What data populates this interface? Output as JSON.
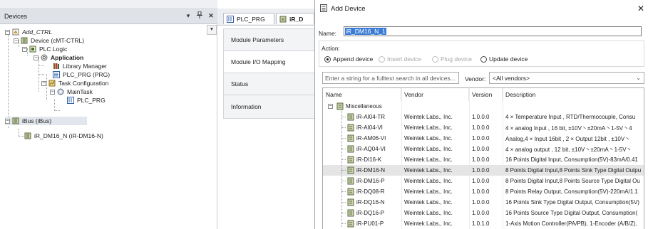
{
  "devices_panel": {
    "title": "Devices",
    "pin_glyph": "▾",
    "dock_glyph": "ᵻ",
    "close_glyph": "✕",
    "scroll_glyph": "▼",
    "tree": [
      {
        "label": "Add_CTRL",
        "italic": true,
        "toggle": "−",
        "icon": "project-icon"
      },
      {
        "label": "Device (cMT-CTRL)",
        "toggle": "−",
        "icon": "device-icon"
      },
      {
        "label": "PLC Logic",
        "toggle": "−",
        "icon": "plc-logic-icon"
      },
      {
        "label": "Application",
        "bold": true,
        "toggle": "−",
        "icon": "application-gear-icon"
      },
      {
        "label": "Library Manager",
        "icon": "library-manager-icon"
      },
      {
        "label": "PLC_PRG (PRG)",
        "icon": "program-icon"
      },
      {
        "label": "Task Configuration",
        "toggle": "−",
        "icon": "task-configuration-icon"
      },
      {
        "label": "MainTask",
        "toggle": "−",
        "icon": "maintask-gear-icon"
      },
      {
        "label": "PLC_PRG",
        "icon": "program-call-icon"
      },
      {
        "label": "iBus (iBus)",
        "toggle": "−",
        "icon": "ibus-icon",
        "selected": true
      },
      {
        "label": "iR_DM16_N (iR-DM16-N)",
        "icon": "module-icon"
      }
    ]
  },
  "editor": {
    "tabs": [
      {
        "label": "PLC_PRG",
        "icon": "program-tab-icon"
      },
      {
        "label": "iR_D",
        "icon": "module-tab-icon"
      }
    ],
    "side_items": [
      {
        "label": "Module Parameters"
      },
      {
        "label": "Module I/O Mapping",
        "active": true
      },
      {
        "label": "Status"
      },
      {
        "label": "Information"
      }
    ]
  },
  "dialog": {
    "title": "Add Device",
    "close_glyph": "✕",
    "name_label": "Name:",
    "name_value": "iR_DM16_N_1",
    "action_label": "Action:",
    "actions": [
      {
        "label": "Append device",
        "selected": true,
        "enabled": true
      },
      {
        "label": "Insert device",
        "selected": false,
        "enabled": false
      },
      {
        "label": "Plug device",
        "selected": false,
        "enabled": false
      },
      {
        "label": "Update device",
        "selected": false,
        "enabled": true
      }
    ],
    "search_placeholder": "Enter a string for a fulltext search in all devices...",
    "vendor_label": "Vendor:",
    "vendor_value": "<All vendors>",
    "vendor_chevron": "⌄",
    "columns": [
      "Name",
      "Vendor",
      "Version",
      "Description"
    ],
    "category": {
      "label": "Miscellaneous",
      "toggle": "−"
    },
    "devices": [
      {
        "name": "iR-AI04-TR",
        "vendor": "Weintek Labs., Inc.",
        "version": "1.0.0.0",
        "description": "4 × Temperature Input , RTD/Thermocouple, Consu"
      },
      {
        "name": "iR-AI04-VI",
        "vendor": "Weintek Labs., Inc.",
        "version": "1.0.0.0",
        "description": "4 × analog Input , 16 bit, ±10V丶±20mA丶1-5V丶4"
      },
      {
        "name": "iR-AM06-VI",
        "vendor": "Weintek Labs., Inc.",
        "version": "1.0.0.0",
        "description": "Analog,4 × Input 16bit , 2 × Output 12bit , ±10V丶"
      },
      {
        "name": "iR-AQ04-VI",
        "vendor": "Weintek Labs., Inc.",
        "version": "1.0.0.0",
        "description": "4 × analog output , 12 bit, ±10V丶±20mA丶1-5V丶"
      },
      {
        "name": "iR-DI16-K",
        "vendor": "Weintek Labs., Inc.",
        "version": "1.0.0.0",
        "description": "16 Points Digital Input, Consumption(5V)-83mA/0.41"
      },
      {
        "name": "iR-DM16-N",
        "vendor": "Weintek Labs., Inc.",
        "version": "1.0.0.0",
        "description": "8 Points Digital Input,8 Points Sink Type Digital Outpu",
        "hover": true
      },
      {
        "name": "iR-DM16-P",
        "vendor": "Weintek Labs., Inc.",
        "version": "1.0.0.0",
        "description": "8 Points Digital Input,8 Points Source Type Digital Ou"
      },
      {
        "name": "iR-DQ08-R",
        "vendor": "Weintek Labs., Inc.",
        "version": "1.0.0.0",
        "description": "8 Points Relay Output, Consumption(5V)-220mA/1.1"
      },
      {
        "name": "iR-DQ16-N",
        "vendor": "Weintek Labs., Inc.",
        "version": "1.0.0.0",
        "description": "16 Points Sink Type Digital Output, Consumption(5V)"
      },
      {
        "name": "iR-DQ16-P",
        "vendor": "Weintek Labs., Inc.",
        "version": "1.0.0.0",
        "description": "16 Points Source Type Digital Output, Consumption("
      },
      {
        "name": "iR-PU01-P",
        "vendor": "Weintek Labs., Inc.",
        "version": "1.0.1.0",
        "description": "1-Axis Motion Controller(PA/PB), 1-Encoder (A/B/Z),"
      }
    ]
  },
  "colors": {
    "selection": "#3a7bd5",
    "hover_row": "#e5e5e5",
    "panel_header": "#dfe3e8",
    "tree_selected": "#e2e7ee"
  }
}
